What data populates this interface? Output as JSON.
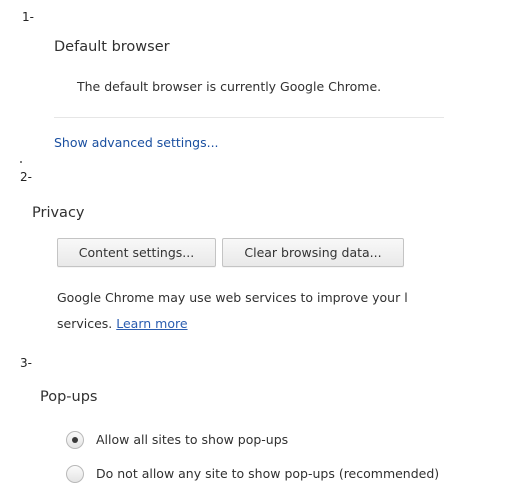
{
  "sections": {
    "one": {
      "number": "1-",
      "title": "Default browser",
      "status": "The default browser is currently Google Chrome.",
      "advanced_link": "Show advanced settings..."
    },
    "two": {
      "number": "2-",
      "title": "Privacy",
      "buttons": {
        "content_settings": "Content settings...",
        "clear_browsing_data": "Clear browsing data..."
      },
      "description_line1": "Google Chrome may use web services to improve your l",
      "description_line2_prefix": "services.",
      "learn_more": "Learn more"
    },
    "three": {
      "number": "3-",
      "title": "Pop-ups",
      "options": [
        {
          "label": "Allow all sites to show pop-ups",
          "selected": true
        },
        {
          "label": "Do not allow any site to show pop-ups (recommended)",
          "selected": false
        }
      ]
    }
  },
  "colors": {
    "link": "#1a4fa0",
    "text": "#303030",
    "divider": "#e6e6e6"
  }
}
